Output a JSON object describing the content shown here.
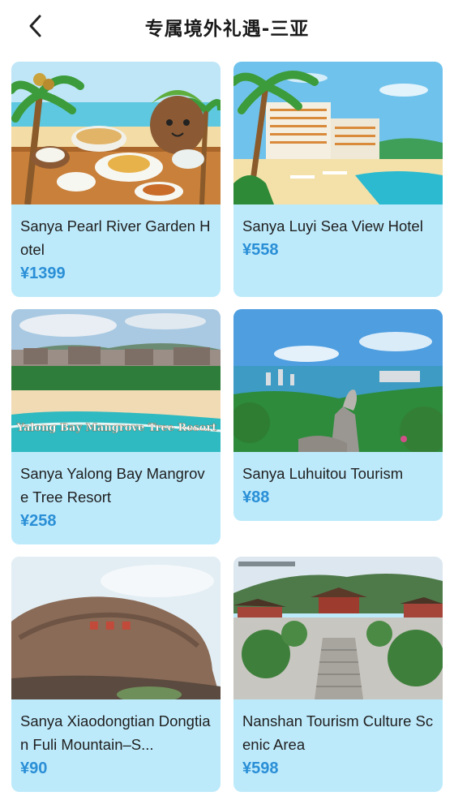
{
  "header": {
    "title": "专属境外礼遇-三亚",
    "back_icon": "chevron-left-icon"
  },
  "colors": {
    "card_bg": "#bdeafb",
    "price": "#2a8fd6"
  },
  "cards": [
    {
      "name": "Sanya Pearl River Garden Hotel",
      "price": "¥1399"
    },
    {
      "name": "Sanya Luyi Sea View Hotel",
      "price": "¥558"
    },
    {
      "name": "Sanya Yalong Bay Mangrove Tree Resort",
      "price": "¥258",
      "image_caption": "Yalong Bay Mangrove Tree Resort"
    },
    {
      "name": "Sanya Luhuitou Tourism",
      "price": "¥88"
    },
    {
      "name": "Sanya Xiaodongtian Dongtian Fuli Mountain–S...",
      "price": "¥90"
    },
    {
      "name": "Nanshan Tourism Culture Scenic Area",
      "price": "¥598"
    }
  ]
}
